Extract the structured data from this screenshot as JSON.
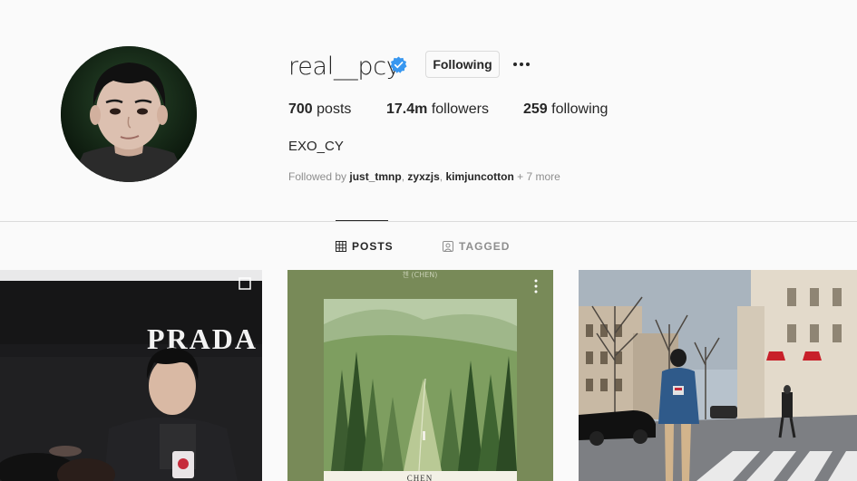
{
  "profile": {
    "username": "real__pcy",
    "follow_button": "Following",
    "stats": {
      "posts_count": "700",
      "posts_label": "posts",
      "followers_count": "17.4m",
      "followers_label": "followers",
      "following_count": "259",
      "following_label": "following"
    },
    "full_name": "EXO_CY",
    "followed_by": {
      "prefix": "Followed by",
      "users": [
        "just_tmnp",
        "zyxzjs",
        "kimjuncotton"
      ],
      "suffix": "+ 7 more"
    }
  },
  "tabs": {
    "posts": "POSTS",
    "tagged": "TAGGED"
  },
  "posts": [
    {
      "overlay_text": "PRADA"
    },
    {
      "header_text": "첸 (CHEN)",
      "footer_text": "CHEN"
    },
    {
      "description": ""
    }
  ],
  "colors": {
    "verified": "#3897f0",
    "text": "#262626",
    "secondary": "#8e8e8e",
    "border": "#dbdbdb",
    "background": "#fafafa"
  }
}
